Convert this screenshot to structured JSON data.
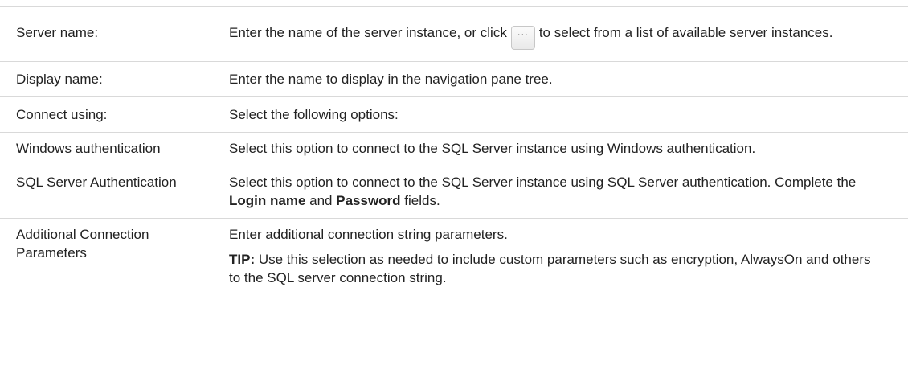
{
  "rows": [
    {
      "term": "Server name:",
      "desc_before": "Enter the name of the server instance, or click",
      "button_glyph": "···",
      "desc_after": "to select from a list of available server instances."
    },
    {
      "term": "Display name:",
      "desc": "Enter the name to display in the navigation pane tree."
    },
    {
      "term": "Connect using:",
      "desc": "Select the following options:"
    },
    {
      "term": "Windows authentication",
      "desc": "Select this option to connect to the SQL Server instance using Windows authentication."
    },
    {
      "term": "SQL Server Authentication",
      "desc_before": "Select this option to connect to the SQL Server instance using SQL Server authentication. Complete the",
      "bold1": "Login name",
      "mid": "and",
      "bold2": "Password",
      "desc_after": "fields."
    },
    {
      "term": "Additional Connection Parameters",
      "desc": "Enter additional connection string parameters.",
      "tip_label": "TIP:",
      "tip_text": "Use this selection as needed to include custom parameters such as encryption, AlwaysOn and others to the SQL server connection string."
    }
  ]
}
